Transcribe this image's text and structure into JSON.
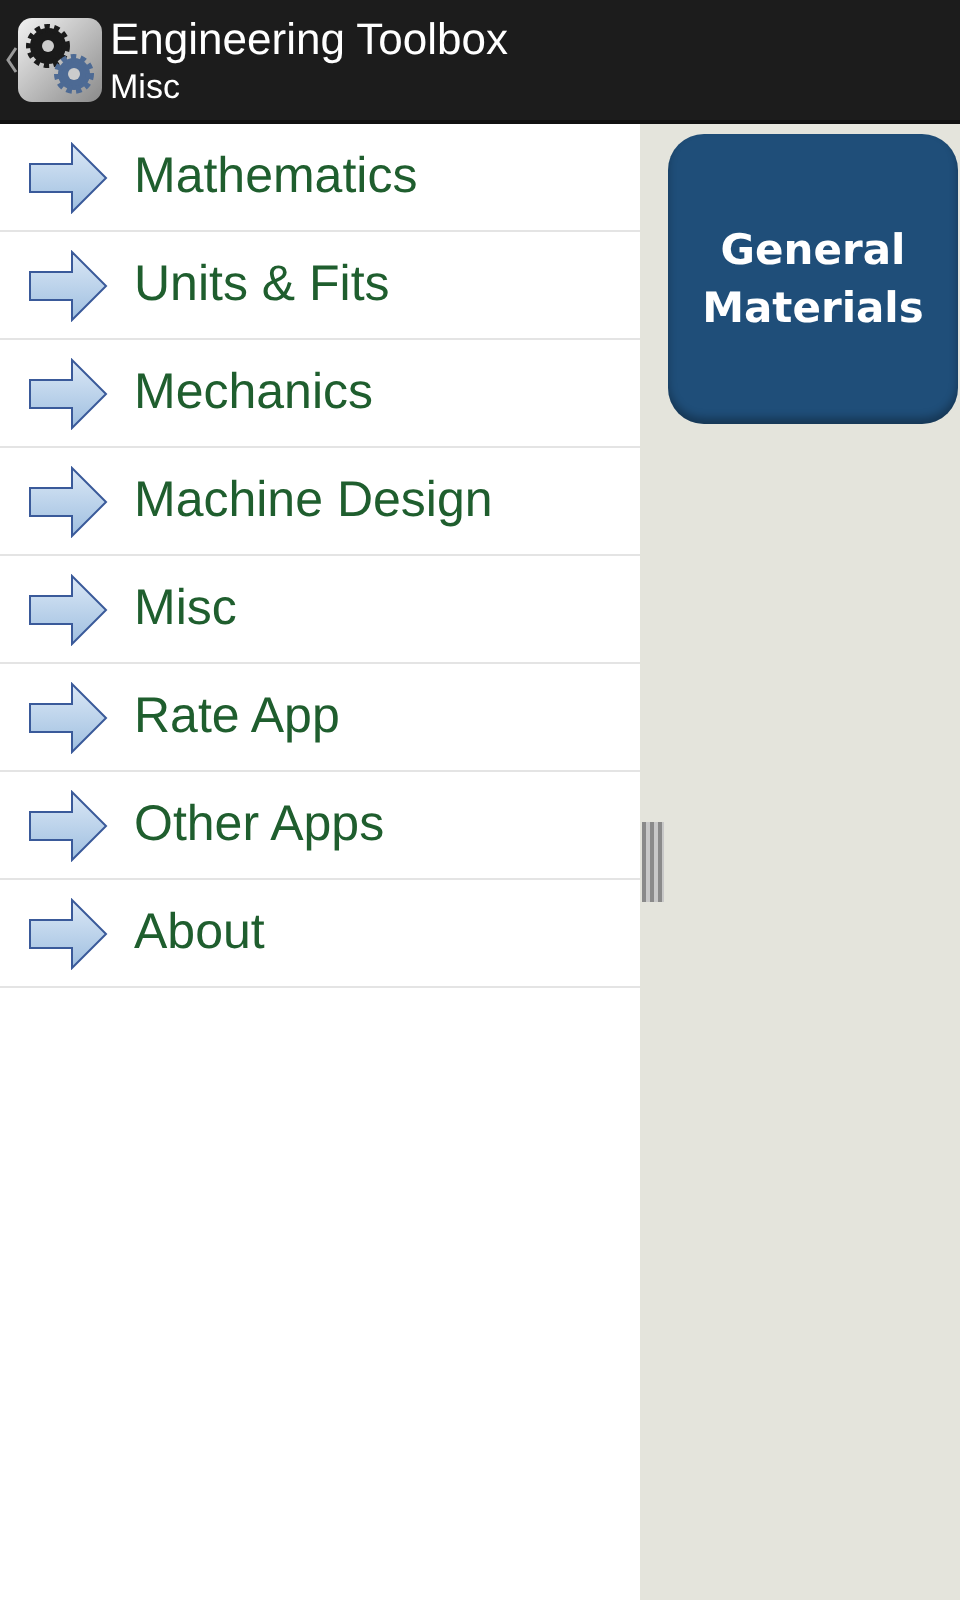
{
  "action_bar": {
    "title": "Engineering Toolbox",
    "subtitle": "Misc"
  },
  "menu": {
    "items": [
      {
        "label": "Mathematics"
      },
      {
        "label": "Units & Fits"
      },
      {
        "label": "Mechanics"
      },
      {
        "label": "Machine Design"
      },
      {
        "label": "Misc"
      },
      {
        "label": "Rate App"
      },
      {
        "label": "Other Apps"
      },
      {
        "label": "About"
      }
    ]
  },
  "tiles": [
    {
      "label": "General Materials"
    }
  ]
}
